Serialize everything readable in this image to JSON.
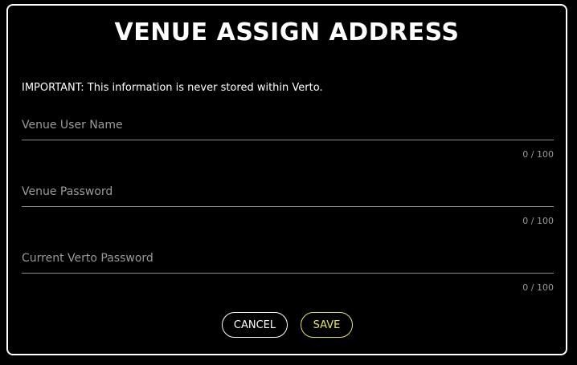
{
  "dialog": {
    "title": "VENUE ASSIGN ADDRESS",
    "notice": "IMPORTANT: This information is never stored within Verto.",
    "fields": [
      {
        "placeholder": "Venue User Name",
        "value": "",
        "counter": "0 / 100"
      },
      {
        "placeholder": "Venue Password",
        "value": "",
        "counter": "0 / 100"
      },
      {
        "placeholder": "Current Verto Password",
        "value": "",
        "counter": "0 / 100"
      }
    ],
    "buttons": {
      "cancel_label": "CANCEL",
      "save_label": "SAVE"
    }
  },
  "colors": {
    "background": "#000000",
    "border": "#ffffff",
    "save_accent": "#e6e65a",
    "muted_text": "#9a9a9a"
  }
}
